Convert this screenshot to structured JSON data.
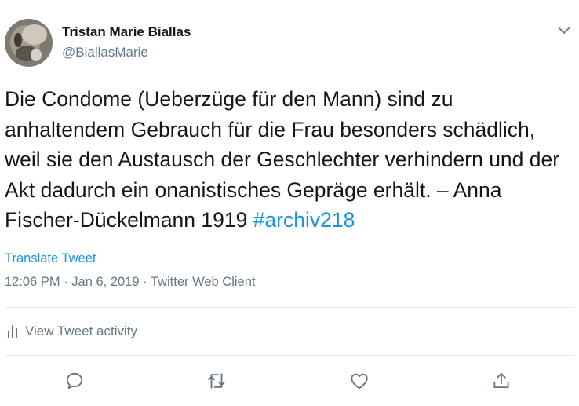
{
  "author": {
    "name": "Tristan Marie Biallas",
    "handle": "@BiallasMarie"
  },
  "tweet": {
    "text": "Die Condome (Ueberzüge für den Mann) sind zu anhaltendem Gebrauch für die Frau besonders schädlich, weil sie den Austausch der Geschlechter verhindern und der Akt dadurch ein onanistisches Gepräge erhält. – Anna Fischer-Dückelmann 1919",
    "hashtag": "#archiv218",
    "translate_label": "Translate Tweet"
  },
  "meta": {
    "time": "12:06 PM",
    "date": "Jan 6, 2019",
    "client": "Twitter Web Client",
    "separator": " · "
  },
  "activity": {
    "label": "View Tweet activity"
  },
  "actions": {
    "reply_icon": "reply-icon",
    "retweet_icon": "retweet-icon",
    "like_icon": "like-icon",
    "share_icon": "share-icon"
  },
  "colors": {
    "link": "#1b95e0",
    "secondary_text": "#657786",
    "divider": "#e6ecf0"
  }
}
